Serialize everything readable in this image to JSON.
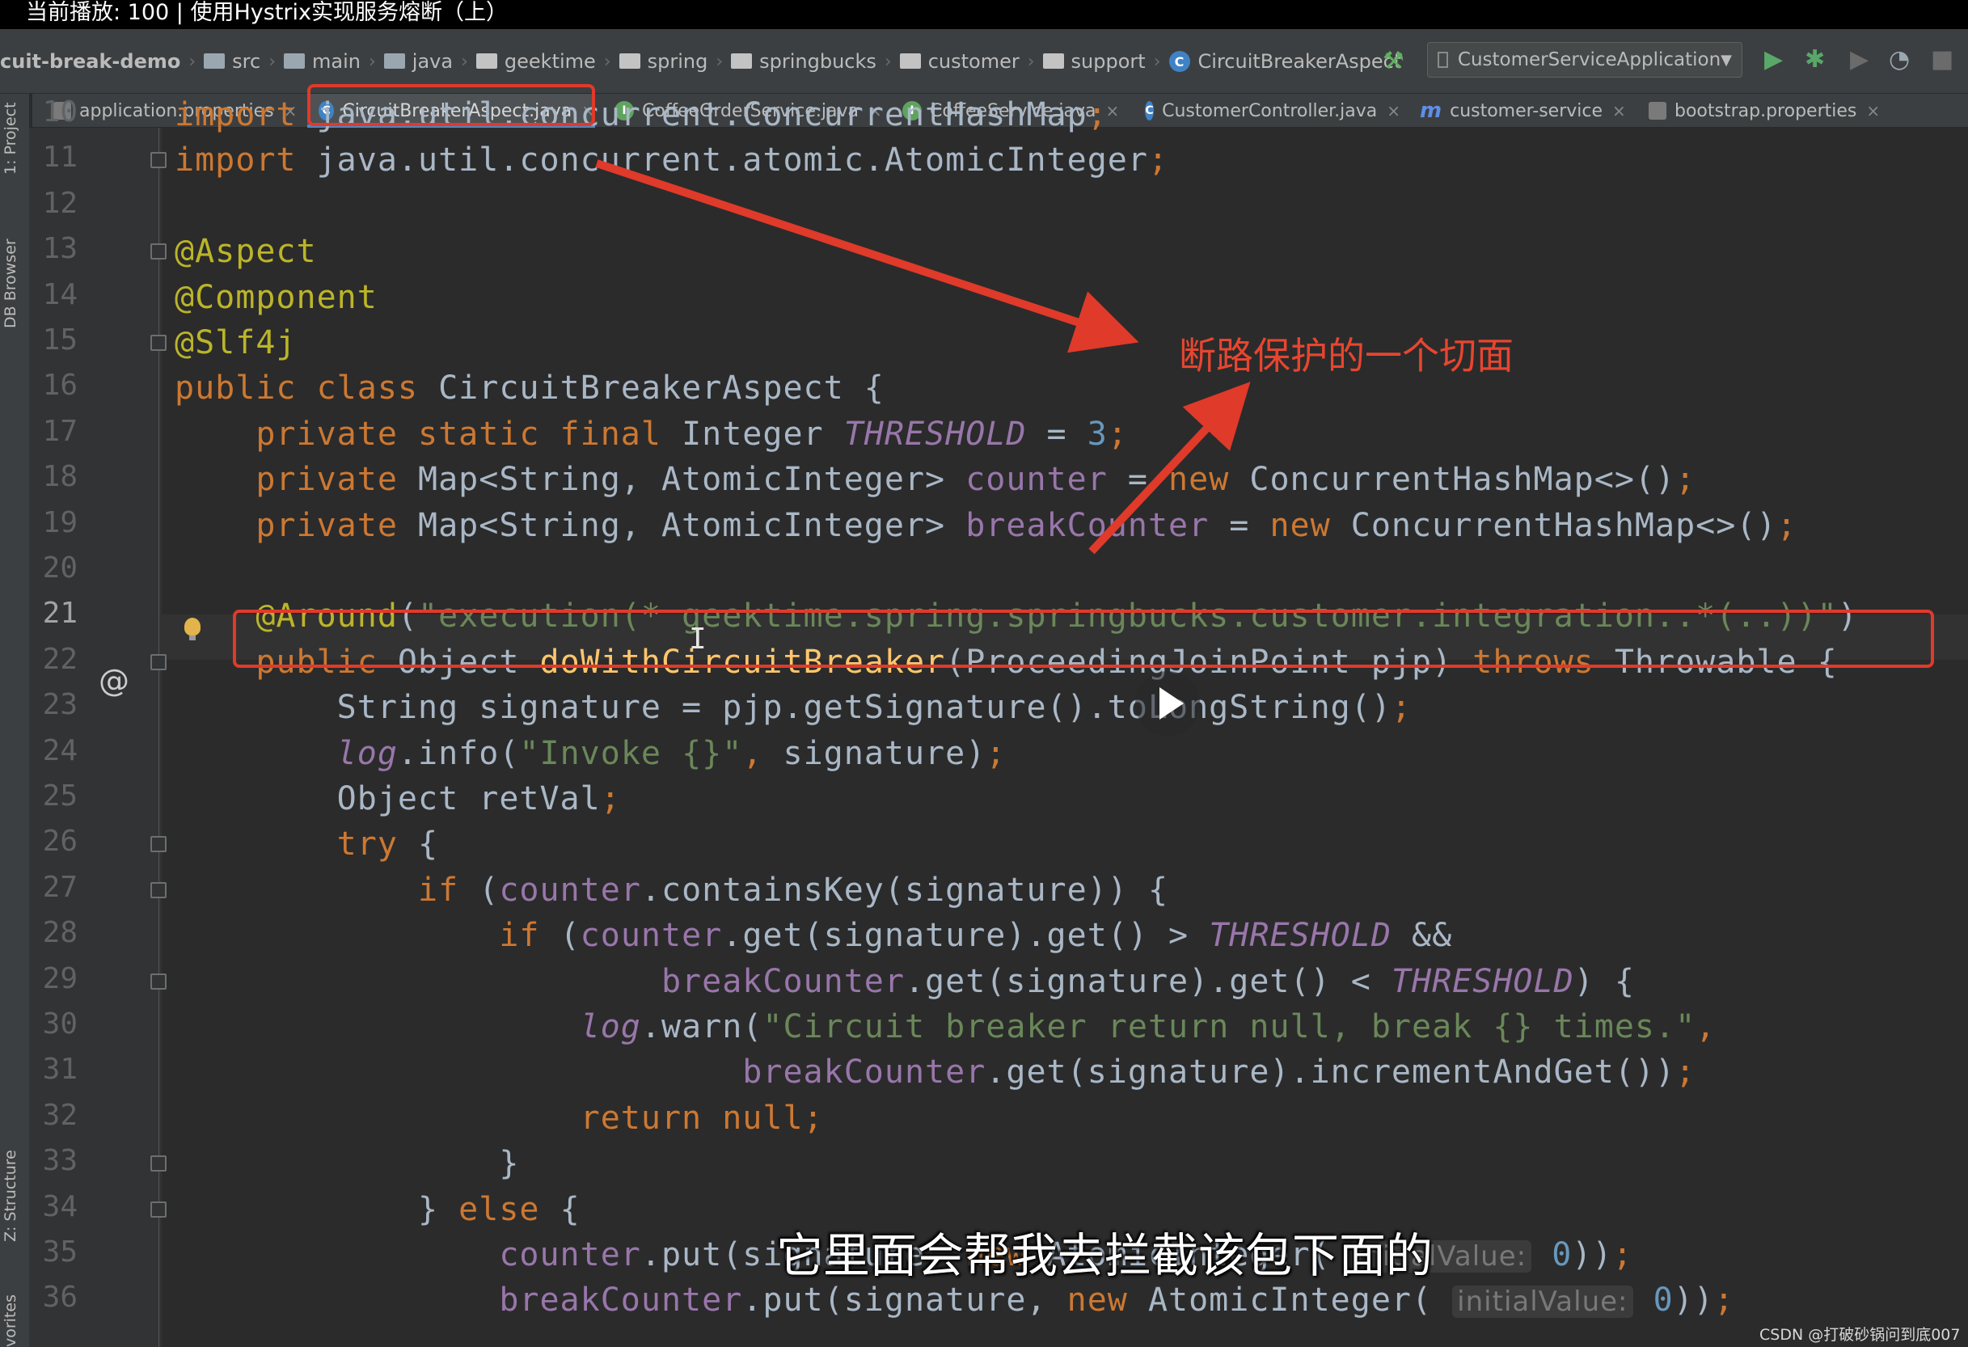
{
  "player": {
    "now_playing": "当前播放: 100 | 使用Hystrix实现服务熔断（上）"
  },
  "breadcrumb": [
    {
      "label": "cuit-break-demo",
      "icon": "none"
    },
    {
      "label": "src",
      "icon": "folder-icon"
    },
    {
      "label": "main",
      "icon": "folder-icon"
    },
    {
      "label": "java",
      "icon": "folder-icon"
    },
    {
      "label": "geektime",
      "icon": "package-icon"
    },
    {
      "label": "spring",
      "icon": "package-icon"
    },
    {
      "label": "springbucks",
      "icon": "package-icon"
    },
    {
      "label": "customer",
      "icon": "package-icon"
    },
    {
      "label": "support",
      "icon": "package-icon"
    },
    {
      "label": "CircuitBreakerAspect",
      "icon": "class-icon"
    }
  ],
  "toolbar": {
    "run_config": "CustomerServiceApplication",
    "icons": [
      "hammer-icon",
      "run-icon",
      "debug-icon",
      "run-with-coverage-icon",
      "profile-icon",
      "stop-icon"
    ]
  },
  "tabs": [
    {
      "label": "application.properties",
      "icon": "properties-icon",
      "active": false
    },
    {
      "label": "CircuitBreakerAspect.java",
      "icon": "class-icon",
      "active": true
    },
    {
      "label": "CoffeeOrderService.java",
      "icon": "interface-icon",
      "active": false
    },
    {
      "label": "CoffeeService.java",
      "icon": "interface-icon",
      "active": false
    },
    {
      "label": "CustomerController.java",
      "icon": "class-icon",
      "active": false
    },
    {
      "label": "customer-service",
      "icon": "maven-icon",
      "active": false
    },
    {
      "label": "bootstrap.properties",
      "icon": "properties-icon",
      "active": false
    }
  ],
  "side_panels": {
    "project": "1: Project",
    "db_browser": "DB Browser",
    "structure": "Z: Structure",
    "favorites": "vorites"
  },
  "editor": {
    "current_line": 21,
    "lines": [
      {
        "n": 10,
        "tokens": [
          [
            "kw",
            "import "
          ],
          [
            "pl",
            "java.util.concurrent.ConcurrentHashMap"
          ],
          [
            "kw",
            ";"
          ]
        ]
      },
      {
        "n": 11,
        "tokens": [
          [
            "kw",
            "import "
          ],
          [
            "pl",
            "java.util.concurrent.atomic.AtomicInteger"
          ],
          [
            "kw",
            ";"
          ]
        ]
      },
      {
        "n": 12,
        "tokens": []
      },
      {
        "n": 13,
        "tokens": [
          [
            "an",
            "@Aspect"
          ]
        ]
      },
      {
        "n": 14,
        "tokens": [
          [
            "an",
            "@Component"
          ]
        ]
      },
      {
        "n": 15,
        "tokens": [
          [
            "an",
            "@Slf4j"
          ]
        ]
      },
      {
        "n": 16,
        "tokens": [
          [
            "kw",
            "public class "
          ],
          [
            "pl",
            "CircuitBreakerAspect {"
          ]
        ]
      },
      {
        "n": 17,
        "tokens": [
          [
            "pl",
            "    "
          ],
          [
            "kw",
            "private static final "
          ],
          [
            "pl",
            "Integer "
          ],
          [
            "ital",
            "THRESHOLD"
          ],
          [
            "pl",
            " = "
          ],
          [
            "num",
            "3"
          ],
          [
            "kw",
            ";"
          ]
        ]
      },
      {
        "n": 18,
        "tokens": [
          [
            "pl",
            "    "
          ],
          [
            "kw",
            "private "
          ],
          [
            "pl",
            "Map<String, AtomicInteger> "
          ],
          [
            "fld",
            "counter"
          ],
          [
            "pl",
            " = "
          ],
          [
            "kw",
            "new "
          ],
          [
            "pl",
            "ConcurrentHashMap<>()"
          ],
          [
            "kw",
            ";"
          ]
        ]
      },
      {
        "n": 19,
        "tokens": [
          [
            "pl",
            "    "
          ],
          [
            "kw",
            "private "
          ],
          [
            "pl",
            "Map<String, AtomicInteger> "
          ],
          [
            "fld",
            "breakCounter"
          ],
          [
            "pl",
            " = "
          ],
          [
            "kw",
            "new "
          ],
          [
            "pl",
            "ConcurrentHashMap<>()"
          ],
          [
            "kw",
            ";"
          ]
        ]
      },
      {
        "n": 20,
        "tokens": []
      },
      {
        "n": 21,
        "tokens": [
          [
            "pl",
            "    "
          ],
          [
            "an",
            "@Around"
          ],
          [
            "pl",
            "("
          ],
          [
            "str",
            "\"execution(* geektime.spring.springbucks.customer.integration..*(..))\""
          ],
          [
            "pl",
            ")"
          ]
        ]
      },
      {
        "n": 22,
        "tokens": [
          [
            "pl",
            "    "
          ],
          [
            "kw",
            "public "
          ],
          [
            "pl",
            "Object "
          ],
          [
            "fn",
            "doWithCircuitBreaker"
          ],
          [
            "pl",
            "(ProceedingJoinPoint pjp) "
          ],
          [
            "kw",
            "throws "
          ],
          [
            "pl",
            "Throwable {"
          ]
        ]
      },
      {
        "n": 23,
        "tokens": [
          [
            "pl",
            "        String signature = pjp.getSignature().toLongString()"
          ],
          [
            "kw",
            ";"
          ]
        ]
      },
      {
        "n": 24,
        "tokens": [
          [
            "pl",
            "        "
          ],
          [
            "ital",
            "log"
          ],
          [
            "pl",
            ".info("
          ],
          [
            "str",
            "\"Invoke {}\""
          ],
          [
            "kw",
            ", "
          ],
          [
            "pl",
            "signature)"
          ],
          [
            "kw",
            ";"
          ]
        ]
      },
      {
        "n": 25,
        "tokens": [
          [
            "pl",
            "        Object retVal"
          ],
          [
            "kw",
            ";"
          ]
        ]
      },
      {
        "n": 26,
        "tokens": [
          [
            "pl",
            "        "
          ],
          [
            "kw",
            "try "
          ],
          [
            "pl",
            "{"
          ]
        ]
      },
      {
        "n": 27,
        "tokens": [
          [
            "pl",
            "            "
          ],
          [
            "kw",
            "if "
          ],
          [
            "pl",
            "("
          ],
          [
            "fld",
            "counter"
          ],
          [
            "pl",
            ".containsKey(signature)) {"
          ]
        ]
      },
      {
        "n": 28,
        "tokens": [
          [
            "pl",
            "                "
          ],
          [
            "kw",
            "if "
          ],
          [
            "pl",
            "("
          ],
          [
            "fld",
            "counter"
          ],
          [
            "pl",
            ".get(signature).get() > "
          ],
          [
            "ital",
            "THRESHOLD"
          ],
          [
            "pl",
            " &&"
          ]
        ]
      },
      {
        "n": 29,
        "tokens": [
          [
            "pl",
            "                        "
          ],
          [
            "fld",
            "breakCounter"
          ],
          [
            "pl",
            ".get(signature).get() < "
          ],
          [
            "ital",
            "THRESHOLD"
          ],
          [
            "pl",
            ") {"
          ]
        ]
      },
      {
        "n": 30,
        "tokens": [
          [
            "pl",
            "                    "
          ],
          [
            "ital",
            "log"
          ],
          [
            "pl",
            ".warn("
          ],
          [
            "str",
            "\"Circuit breaker return null, break {} times.\""
          ],
          [
            "kw",
            ","
          ]
        ]
      },
      {
        "n": 31,
        "tokens": [
          [
            "pl",
            "                            "
          ],
          [
            "fld",
            "breakCounter"
          ],
          [
            "pl",
            ".get(signature).incrementAndGet())"
          ],
          [
            "kw",
            ";"
          ]
        ]
      },
      {
        "n": 32,
        "tokens": [
          [
            "pl",
            "                    "
          ],
          [
            "kw",
            "return null;"
          ]
        ]
      },
      {
        "n": 33,
        "tokens": [
          [
            "pl",
            "                }"
          ]
        ]
      },
      {
        "n": 34,
        "tokens": [
          [
            "pl",
            "            } "
          ],
          [
            "kw",
            "else "
          ],
          [
            "pl",
            "{"
          ]
        ]
      },
      {
        "n": 35,
        "tokens": [
          [
            "pl",
            "                "
          ],
          [
            "fld",
            "counter"
          ],
          [
            "pl",
            ".put(signature, "
          ],
          [
            "kw",
            "new "
          ],
          [
            "pl",
            "AtomicInteger( "
          ],
          [
            "hint",
            "initialValue:"
          ],
          [
            "pl",
            " "
          ],
          [
            "num",
            "0"
          ],
          [
            "pl",
            "))"
          ],
          [
            "kw",
            ";"
          ]
        ]
      },
      {
        "n": 36,
        "tokens": [
          [
            "pl",
            "                "
          ],
          [
            "fld",
            "breakCounter"
          ],
          [
            "pl",
            ".put(signature, "
          ],
          [
            "kw",
            "new "
          ],
          [
            "pl",
            "AtomicInteger( "
          ],
          [
            "hint",
            "initialValue:"
          ],
          [
            "pl",
            " "
          ],
          [
            "num",
            "0"
          ],
          [
            "pl",
            "))"
          ],
          [
            "kw",
            ";"
          ]
        ]
      }
    ]
  },
  "annotation": {
    "text": "断路保护的一个切面"
  },
  "subtitle": {
    "text": "它里面会帮我去拦截该包下面的"
  },
  "watermark": {
    "text": "CSDN @打破砂锅问到底007"
  },
  "colors": {
    "highlight": "#e03a2a",
    "accent": "#4a88c7",
    "background": "#2b2b2b"
  }
}
